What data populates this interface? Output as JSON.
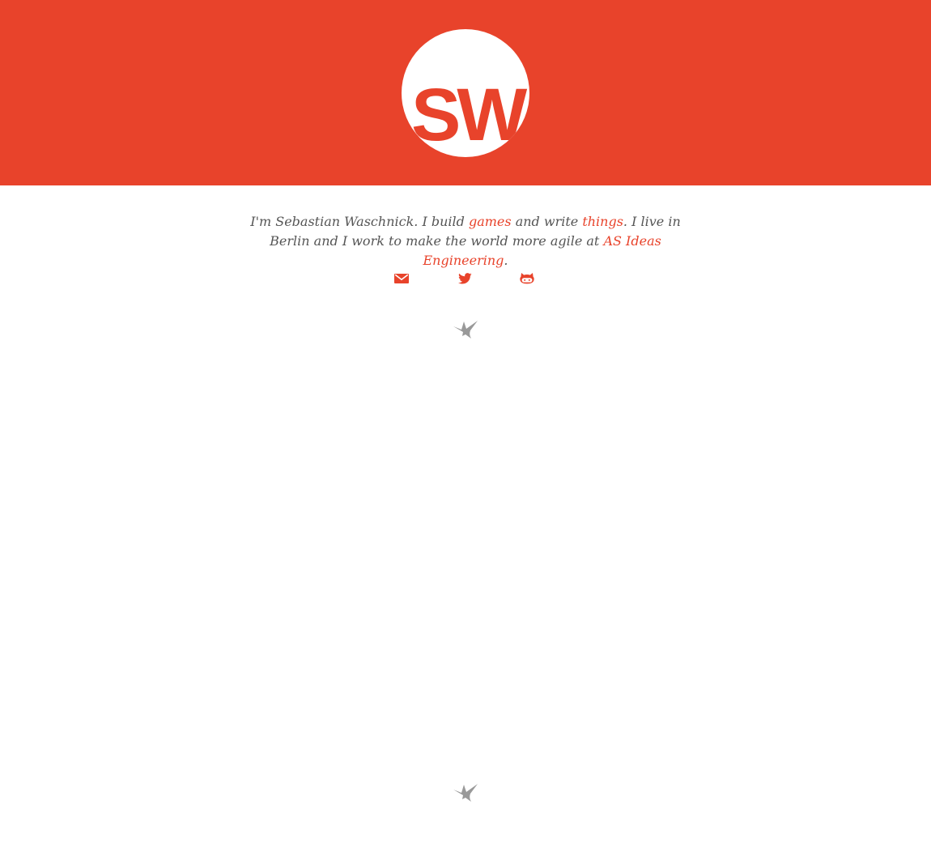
{
  "header": {
    "logo_text": "SW",
    "background_color": "#e8432b"
  },
  "intro": {
    "part1": "I'm Sebastian Waschnick. I build ",
    "link_games": "games",
    "part2": " and write ",
    "link_things": "things",
    "part3": ". I live in Berlin and I work to make the world more agile at ",
    "link_company": "AS Ideas Engineering",
    "part4": "."
  },
  "social": [
    {
      "name": "email",
      "icon": "mail-icon"
    },
    {
      "name": "twitter",
      "icon": "twitter-icon"
    },
    {
      "name": "github",
      "icon": "github-icon"
    }
  ],
  "decorations": {
    "bird_icon": "hummingbird-icon",
    "bird_color": "#999999",
    "accent_color": "#e8432b",
    "text_color": "#555555"
  }
}
